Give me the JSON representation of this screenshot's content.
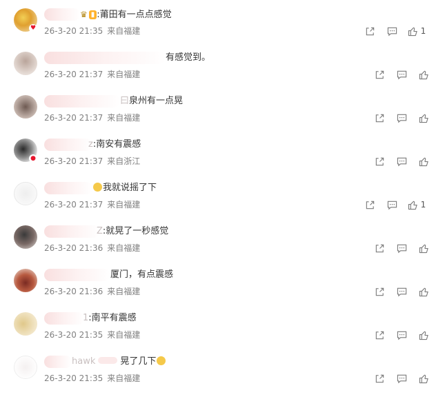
{
  "comments": [
    {
      "text": ":莆田有一点点感觉",
      "date": "26-3-20 21:35",
      "location": "来自福建",
      "likes": "1"
    },
    {
      "text": "有感觉到。",
      "date": "26-3-20 21:37",
      "location": "来自福建",
      "likes": ""
    },
    {
      "text": "泉州有一点晃",
      "date": "26-3-20 21:37",
      "location": "来自福建",
      "likes": ""
    },
    {
      "text": ":南安有震感",
      "date": "26-3-20 21:37",
      "location": "来自浙江",
      "likes": ""
    },
    {
      "text": "我就说摇了下",
      "date": "26-3-20 21:37",
      "location": "来自福建",
      "likes": "1"
    },
    {
      "text": ":就晃了一秒感觉",
      "date": "26-3-20 21:36",
      "location": "来自福建",
      "likes": ""
    },
    {
      "text": "厦门，有点震感",
      "date": "26-3-20 21:36",
      "location": "来自福建",
      "likes": ""
    },
    {
      "text": ":南平有震感",
      "date": "26-3-20 21:35",
      "location": "来自福建",
      "likes": ""
    },
    {
      "text": "晃了几下",
      "date": "26-3-20 21:35",
      "location": "来自福建",
      "likes": ""
    }
  ],
  "name_fragments": {
    "c2": "曰",
    "c4": "z",
    "c6": "Z",
    "c8": "1",
    "c9": "hawk"
  },
  "icons": [
    "share-icon",
    "comment-icon",
    "like-icon"
  ],
  "colors": {
    "text": "#333333",
    "meta": "#808080",
    "icon": "#7a7a7a",
    "blur": "#f8dcdc"
  }
}
